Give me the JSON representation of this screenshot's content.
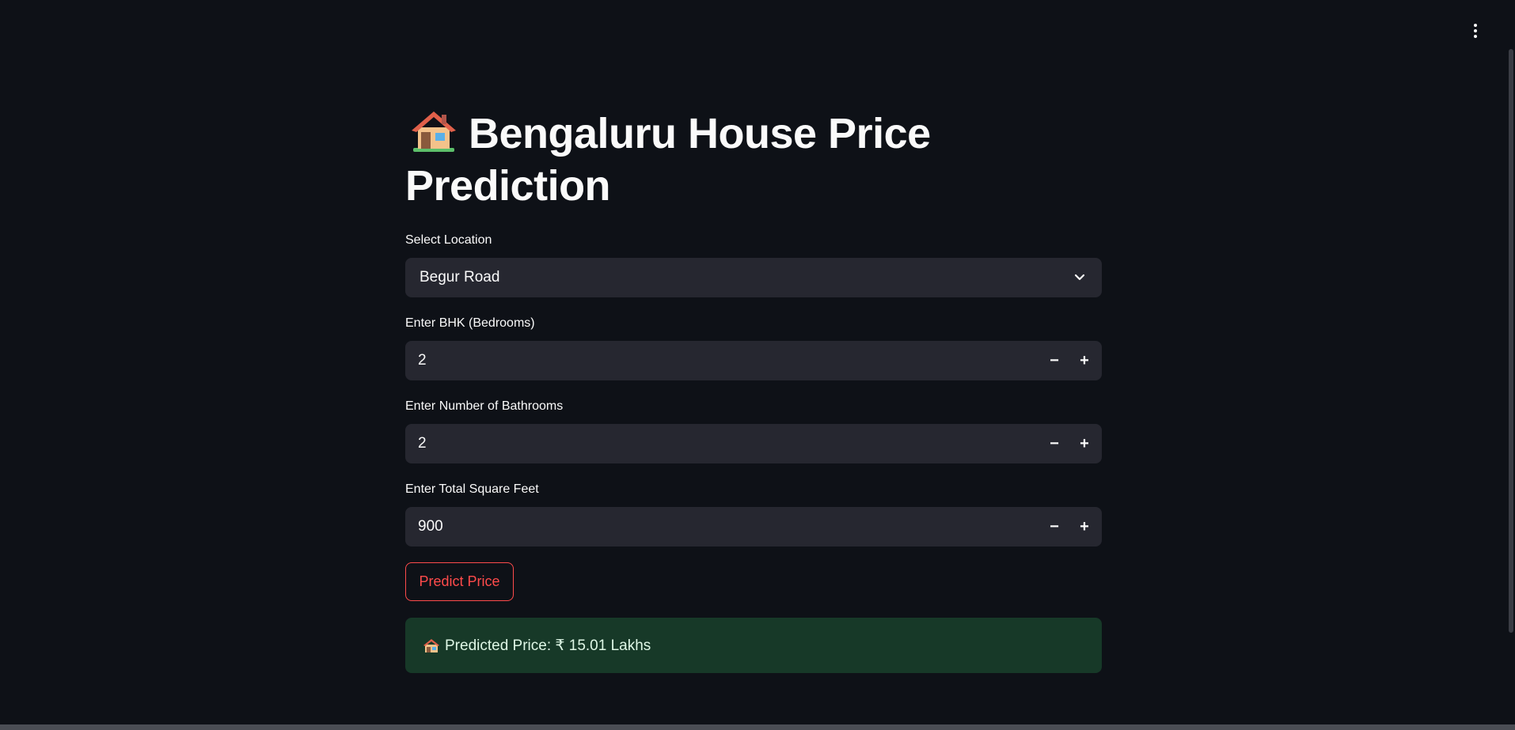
{
  "app": {
    "title": "Bengaluru House Price Prediction",
    "title_icon": "house-icon",
    "menu_icon": "kebab-menu-icon"
  },
  "location": {
    "label": "Select Location",
    "value": "Begur Road"
  },
  "bhk": {
    "label": "Enter BHK (Bedrooms)",
    "value": "2"
  },
  "bath": {
    "label": "Enter Number of Bathrooms",
    "value": "2"
  },
  "sqft": {
    "label": "Enter Total Square Feet",
    "value": "900"
  },
  "stepper": {
    "minus": "−",
    "plus": "+"
  },
  "predict_button": {
    "label": "Predict Price"
  },
  "result": {
    "text": "Predicted Price: ₹ 15.01 Lakhs",
    "icon": "house-icon"
  },
  "colors": {
    "background": "#0e1117",
    "input_bg": "#262730",
    "accent": "#ff4b4b",
    "success_bg": "#173928"
  }
}
